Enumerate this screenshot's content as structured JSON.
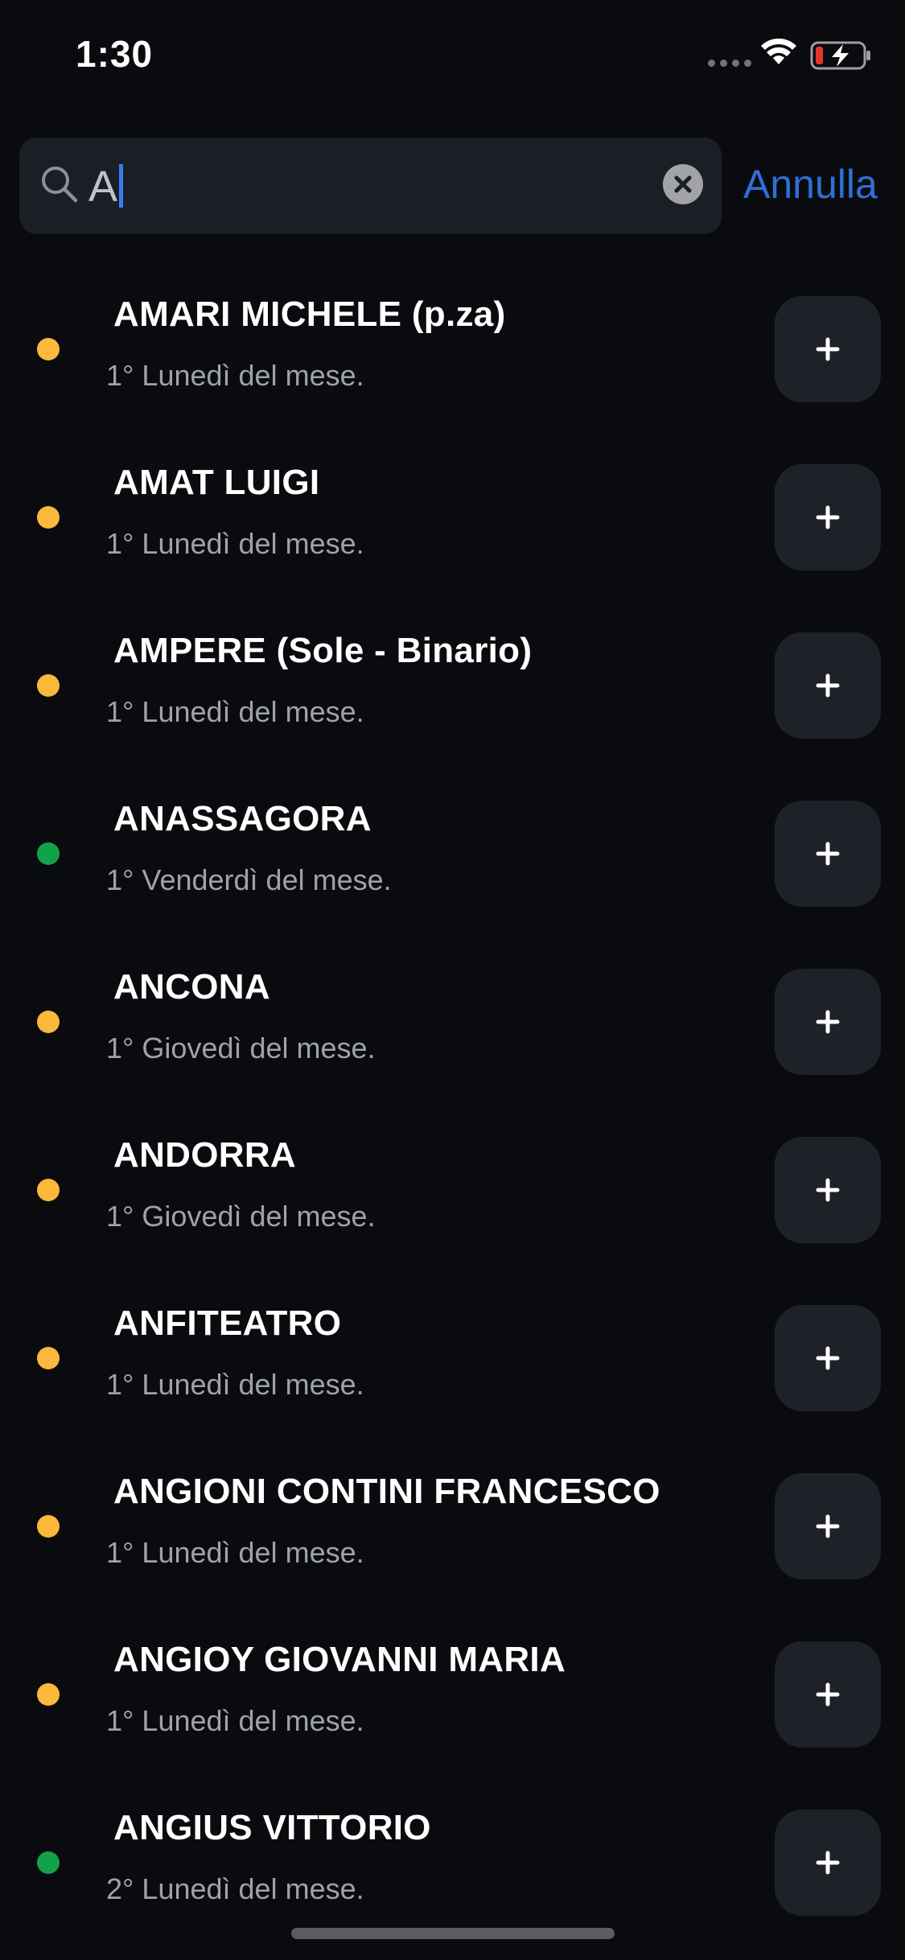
{
  "status_bar": {
    "time": "1:30"
  },
  "search": {
    "query": "A",
    "cancel_label": "Annulla"
  },
  "results": [
    {
      "title": "AMARI MICHELE (p.za)",
      "subtitle": "1° Lunedì del mese.",
      "status_color": "#fcb83b"
    },
    {
      "title": "AMAT LUIGI",
      "subtitle": "1° Lunedì del mese.",
      "status_color": "#fcb83b"
    },
    {
      "title": "AMPERE (Sole - Binario)",
      "subtitle": "1° Lunedì del mese.",
      "status_color": "#fcb83b"
    },
    {
      "title": "ANASSAGORA",
      "subtitle": "1° Venderdì del mese.",
      "status_color": "#13a24a"
    },
    {
      "title": "ANCONA",
      "subtitle": "1° Giovedì del mese.",
      "status_color": "#fcb83b"
    },
    {
      "title": "ANDORRA",
      "subtitle": "1° Giovedì del mese.",
      "status_color": "#fcb83b"
    },
    {
      "title": "ANFITEATRO",
      "subtitle": "1° Lunedì del mese.",
      "status_color": "#fcb83b"
    },
    {
      "title": "ANGIONI CONTINI FRANCESCO",
      "subtitle": "1° Lunedì del mese.",
      "status_color": "#fcb83b"
    },
    {
      "title": "ANGIOY GIOVANNI MARIA",
      "subtitle": "1° Lunedì del mese.",
      "status_color": "#fcb83b"
    },
    {
      "title": "ANGIUS VITTORIO",
      "subtitle": "2° Lunedì del mese.",
      "status_color": "#13a24a"
    }
  ],
  "icons": {
    "search": "search-icon",
    "clear": "clear-icon",
    "add": "plus-icon",
    "wifi": "wifi-icon",
    "battery": "battery-charging-icon"
  },
  "colors": {
    "background": "#0a0b0f",
    "accent": "#2f6fd6",
    "status_yellow": "#fcb83b",
    "status_green": "#13a24a"
  }
}
